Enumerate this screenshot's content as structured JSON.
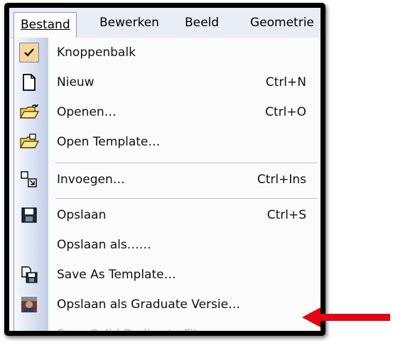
{
  "menubar": {
    "items": [
      {
        "label": "Bestand"
      },
      {
        "label": "Bewerken"
      },
      {
        "label": "Beeld"
      },
      {
        "label": "Geometrie"
      }
    ]
  },
  "menu": {
    "items": [
      {
        "label": "Knoppenbalk",
        "shortcut": "",
        "icon": "checkmark-icon",
        "checked": true
      },
      {
        "label": "Nieuw",
        "shortcut": "Ctrl+N",
        "icon": "new-document-icon"
      },
      {
        "label": "Openen…",
        "shortcut": "Ctrl+O",
        "icon": "open-folder-icon"
      },
      {
        "label": "Open Template…",
        "shortcut": "",
        "icon": "open-template-icon"
      },
      {
        "label": "Invoegen…",
        "shortcut": "Ctrl+Ins",
        "icon": "insert-icon"
      },
      {
        "label": "Opslaan",
        "shortcut": "Ctrl+S",
        "icon": "save-disk-icon"
      },
      {
        "label": "Opslaan als……",
        "shortcut": "",
        "icon": ""
      },
      {
        "label": "Save As Template…",
        "shortcut": "",
        "icon": "save-template-icon"
      },
      {
        "label": "Opslaan als Graduate Versie…",
        "shortcut": "",
        "icon": "graduate-icon"
      },
      {
        "label": "Save Solid Bodies to Files",
        "shortcut": "",
        "icon": "",
        "disabled": true
      }
    ]
  },
  "colors": {
    "highlight_arrow": "#e30613",
    "checked_background": "#f7d59b",
    "menubar_background": "#e9edf6"
  }
}
